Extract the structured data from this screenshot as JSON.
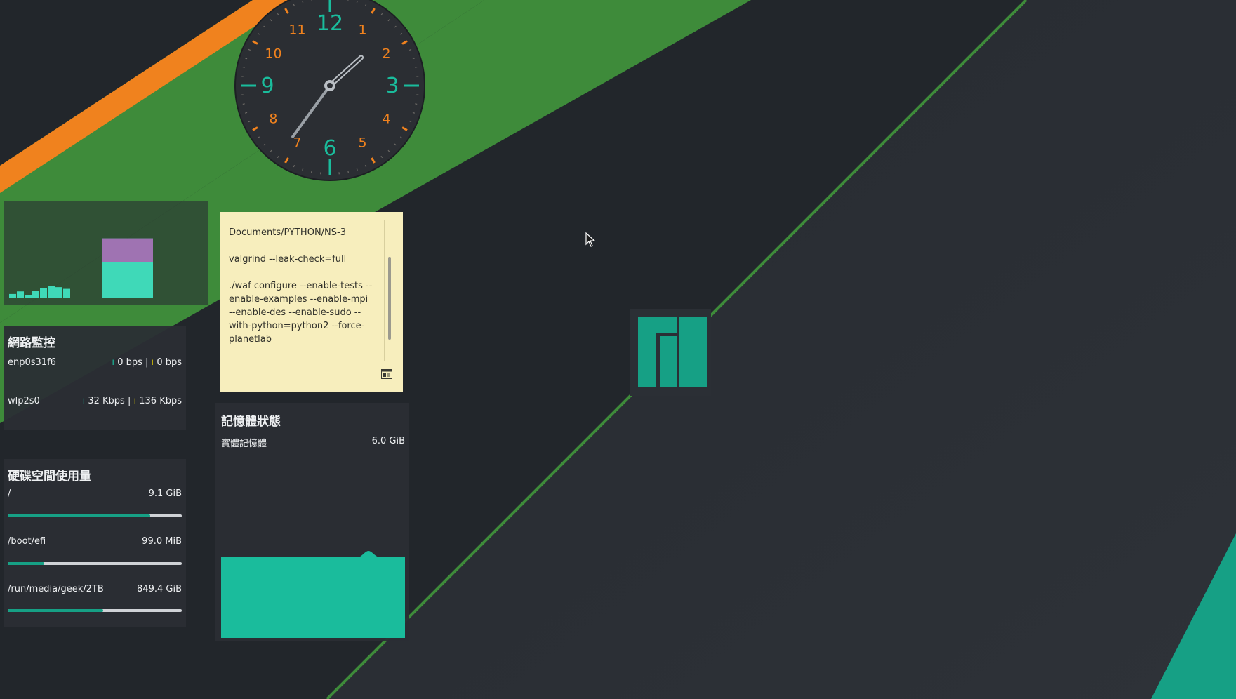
{
  "clock": {
    "hour_numerals": [
      "12",
      "1",
      "2",
      "3",
      "4",
      "5",
      "6",
      "7",
      "8",
      "9",
      "10",
      "11"
    ],
    "time": "1:36",
    "colors": {
      "face": "#2b2e33",
      "accent": "#1abc9c",
      "orange": "#f0821e",
      "hand": "#9aa0a6"
    }
  },
  "graph_widget": {
    "bars": [
      0.05,
      0.08,
      0.04,
      0.09,
      0.12,
      0.14,
      0.13,
      0.11
    ],
    "peak": 1.0,
    "colors": {
      "bar": "#3fd9b8",
      "peak_top": "#b060b0"
    }
  },
  "network": {
    "title": "網路監控",
    "interfaces": [
      {
        "name": "enp0s31f6",
        "down": "0 bps",
        "sep": "|",
        "up": "0 bps"
      },
      {
        "name": "wlp2s0",
        "down": "32 Kbps",
        "sep": "|",
        "up": "136 Kbps"
      }
    ]
  },
  "disk": {
    "title": "硬碟空間使用量",
    "mounts": [
      {
        "path": "/",
        "size": "9.1 GiB",
        "used_fraction": 0.82
      },
      {
        "path": "/boot/efi",
        "size": "99.0 MiB",
        "used_fraction": 0.21
      },
      {
        "path": "/run/media/geek/2TB",
        "size": "849.4 GiB",
        "used_fraction": 0.55
      }
    ]
  },
  "note": {
    "lines": [
      "Documents/PYTHON/NS-3",
      "valgrind --leak-check=full",
      "./waf configure --enable-tests --enable-examples --enable-mpi --enable-des --enable-sudo --with-python=python2 --force-planetlab"
    ],
    "menu_icon": "note-menu-icon"
  },
  "memory": {
    "title": "記憶體狀態",
    "label": "實體記憶體",
    "total": "6.0 GiB",
    "usage_fraction": 0.5
  },
  "colors": {
    "background": "#22262b",
    "orange": "#f0821e",
    "green": "#3e8b3a",
    "teal": "#16a085"
  },
  "logo": {
    "icon": "manjaro-logo-icon"
  },
  "cursor": {
    "icon": "mouse-pointer-icon"
  }
}
